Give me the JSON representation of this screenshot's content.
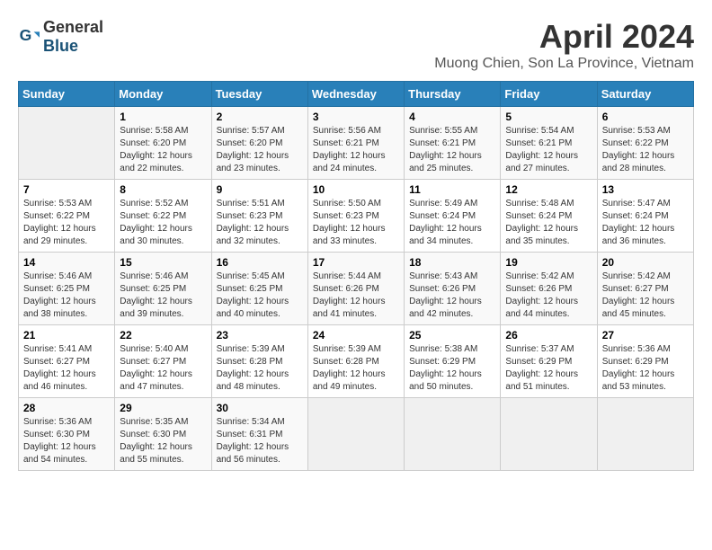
{
  "header": {
    "logo_general": "General",
    "logo_blue": "Blue",
    "title": "April 2024",
    "location": "Muong Chien, Son La Province, Vietnam"
  },
  "calendar": {
    "days_of_week": [
      "Sunday",
      "Monday",
      "Tuesday",
      "Wednesday",
      "Thursday",
      "Friday",
      "Saturday"
    ],
    "weeks": [
      [
        {
          "day": "",
          "details": ""
        },
        {
          "day": "1",
          "details": "Sunrise: 5:58 AM\nSunset: 6:20 PM\nDaylight: 12 hours\nand 22 minutes."
        },
        {
          "day": "2",
          "details": "Sunrise: 5:57 AM\nSunset: 6:20 PM\nDaylight: 12 hours\nand 23 minutes."
        },
        {
          "day": "3",
          "details": "Sunrise: 5:56 AM\nSunset: 6:21 PM\nDaylight: 12 hours\nand 24 minutes."
        },
        {
          "day": "4",
          "details": "Sunrise: 5:55 AM\nSunset: 6:21 PM\nDaylight: 12 hours\nand 25 minutes."
        },
        {
          "day": "5",
          "details": "Sunrise: 5:54 AM\nSunset: 6:21 PM\nDaylight: 12 hours\nand 27 minutes."
        },
        {
          "day": "6",
          "details": "Sunrise: 5:53 AM\nSunset: 6:22 PM\nDaylight: 12 hours\nand 28 minutes."
        }
      ],
      [
        {
          "day": "7",
          "details": "Sunrise: 5:53 AM\nSunset: 6:22 PM\nDaylight: 12 hours\nand 29 minutes."
        },
        {
          "day": "8",
          "details": "Sunrise: 5:52 AM\nSunset: 6:22 PM\nDaylight: 12 hours\nand 30 minutes."
        },
        {
          "day": "9",
          "details": "Sunrise: 5:51 AM\nSunset: 6:23 PM\nDaylight: 12 hours\nand 32 minutes."
        },
        {
          "day": "10",
          "details": "Sunrise: 5:50 AM\nSunset: 6:23 PM\nDaylight: 12 hours\nand 33 minutes."
        },
        {
          "day": "11",
          "details": "Sunrise: 5:49 AM\nSunset: 6:24 PM\nDaylight: 12 hours\nand 34 minutes."
        },
        {
          "day": "12",
          "details": "Sunrise: 5:48 AM\nSunset: 6:24 PM\nDaylight: 12 hours\nand 35 minutes."
        },
        {
          "day": "13",
          "details": "Sunrise: 5:47 AM\nSunset: 6:24 PM\nDaylight: 12 hours\nand 36 minutes."
        }
      ],
      [
        {
          "day": "14",
          "details": "Sunrise: 5:46 AM\nSunset: 6:25 PM\nDaylight: 12 hours\nand 38 minutes."
        },
        {
          "day": "15",
          "details": "Sunrise: 5:46 AM\nSunset: 6:25 PM\nDaylight: 12 hours\nand 39 minutes."
        },
        {
          "day": "16",
          "details": "Sunrise: 5:45 AM\nSunset: 6:25 PM\nDaylight: 12 hours\nand 40 minutes."
        },
        {
          "day": "17",
          "details": "Sunrise: 5:44 AM\nSunset: 6:26 PM\nDaylight: 12 hours\nand 41 minutes."
        },
        {
          "day": "18",
          "details": "Sunrise: 5:43 AM\nSunset: 6:26 PM\nDaylight: 12 hours\nand 42 minutes."
        },
        {
          "day": "19",
          "details": "Sunrise: 5:42 AM\nSunset: 6:26 PM\nDaylight: 12 hours\nand 44 minutes."
        },
        {
          "day": "20",
          "details": "Sunrise: 5:42 AM\nSunset: 6:27 PM\nDaylight: 12 hours\nand 45 minutes."
        }
      ],
      [
        {
          "day": "21",
          "details": "Sunrise: 5:41 AM\nSunset: 6:27 PM\nDaylight: 12 hours\nand 46 minutes."
        },
        {
          "day": "22",
          "details": "Sunrise: 5:40 AM\nSunset: 6:27 PM\nDaylight: 12 hours\nand 47 minutes."
        },
        {
          "day": "23",
          "details": "Sunrise: 5:39 AM\nSunset: 6:28 PM\nDaylight: 12 hours\nand 48 minutes."
        },
        {
          "day": "24",
          "details": "Sunrise: 5:39 AM\nSunset: 6:28 PM\nDaylight: 12 hours\nand 49 minutes."
        },
        {
          "day": "25",
          "details": "Sunrise: 5:38 AM\nSunset: 6:29 PM\nDaylight: 12 hours\nand 50 minutes."
        },
        {
          "day": "26",
          "details": "Sunrise: 5:37 AM\nSunset: 6:29 PM\nDaylight: 12 hours\nand 51 minutes."
        },
        {
          "day": "27",
          "details": "Sunrise: 5:36 AM\nSunset: 6:29 PM\nDaylight: 12 hours\nand 53 minutes."
        }
      ],
      [
        {
          "day": "28",
          "details": "Sunrise: 5:36 AM\nSunset: 6:30 PM\nDaylight: 12 hours\nand 54 minutes."
        },
        {
          "day": "29",
          "details": "Sunrise: 5:35 AM\nSunset: 6:30 PM\nDaylight: 12 hours\nand 55 minutes."
        },
        {
          "day": "30",
          "details": "Sunrise: 5:34 AM\nSunset: 6:31 PM\nDaylight: 12 hours\nand 56 minutes."
        },
        {
          "day": "",
          "details": ""
        },
        {
          "day": "",
          "details": ""
        },
        {
          "day": "",
          "details": ""
        },
        {
          "day": "",
          "details": ""
        }
      ]
    ]
  }
}
